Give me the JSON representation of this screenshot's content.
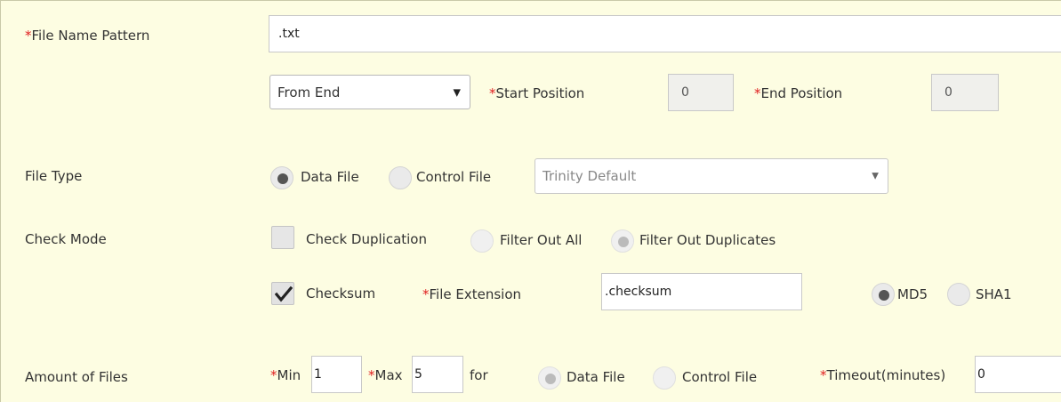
{
  "file_name_pattern": {
    "label": "File Name Pattern",
    "value": ".txt",
    "position_mode": "From End",
    "start_position_label": "Start Position",
    "start_position_value": "0",
    "end_position_label": "End Position",
    "end_position_value": "0"
  },
  "file_type": {
    "label": "File Type",
    "options": [
      "Data File",
      "Control File"
    ],
    "selected": "Data File",
    "template_select": "Trinity Default"
  },
  "check_mode": {
    "label": "Check Mode",
    "check_duplication_label": "Check Duplication",
    "check_duplication_checked": false,
    "filter_out_all_label": "Filter Out All",
    "filter_out_duplicates_label": "Filter Out Duplicates",
    "filter_selected": "Filter Out Duplicates",
    "checksum_label": "Checksum",
    "checksum_checked": true,
    "file_extension_label": "File Extension",
    "file_extension_value": ".checksum",
    "algorithm_options": [
      "MD5",
      "SHA1"
    ],
    "algorithm_selected": "MD5"
  },
  "amount_of_files": {
    "label": "Amount of Files",
    "min_label": "Min",
    "min_value": "1",
    "max_label": "Max",
    "max_value": "5",
    "for_label": "for",
    "options": [
      "Data File",
      "Control File"
    ],
    "selected": "Data File",
    "timeout_label": "Timeout(minutes)",
    "timeout_value": "0"
  },
  "colors": {
    "background": "#fdfde2",
    "required_marker": "#e02020"
  }
}
